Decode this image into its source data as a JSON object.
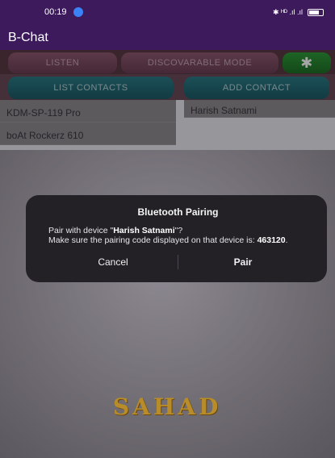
{
  "status": {
    "time": "00:19",
    "right_text": "✱ ᴴᴰ .ıl .ıl"
  },
  "app": {
    "title": "B-Chat"
  },
  "tabs": {
    "listen": "LISTEN",
    "discoverable": "DISCOVARABLE MODE",
    "bluetooth_icon": "bluetooth-icon"
  },
  "actions": {
    "list_contacts": "LIST CONTACTS",
    "add_contact": "ADD CONTACT"
  },
  "paired_devices": [
    "KDM-SP-119 Pro",
    "boAt Rockerz 610"
  ],
  "contacts": [
    "Harish Satnami"
  ],
  "dialog": {
    "title": "Bluetooth Pairing",
    "line1_pre": "Pair with device \"",
    "device": "Harish Satnami",
    "line1_post": "\"?",
    "line2": "Make sure the pairing code displayed on that device is: ",
    "code": "463120",
    "line2_post": ".",
    "cancel": "Cancel",
    "pair": "Pair"
  },
  "logo_text": "SAHAD",
  "colors": {
    "header": "#3d1a5c",
    "bt_green": "#2f9b3a",
    "action_teal": "#2b7a86"
  }
}
